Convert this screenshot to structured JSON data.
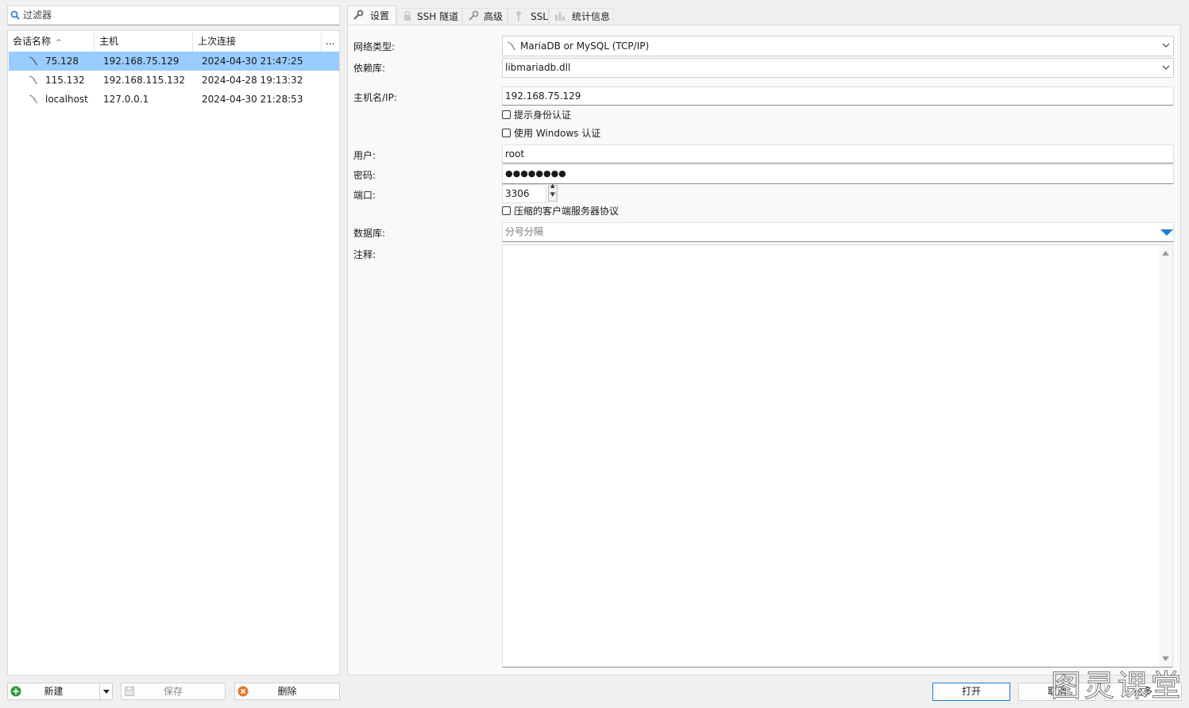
{
  "filter": {
    "placeholder": "过滤器"
  },
  "session_list": {
    "columns": [
      "会话名称",
      "主机",
      "上次连接",
      "..."
    ],
    "rows": [
      {
        "name": "75.128",
        "host": "192.168.75.129",
        "last": "2024-04-30 21:47:25",
        "selected": true
      },
      {
        "name": "115.132",
        "host": "192.168.115.132",
        "last": "2024-04-28 19:13:32",
        "selected": false
      },
      {
        "name": "localhost",
        "host": "127.0.0.1",
        "last": "2024-04-30 21:28:53",
        "selected": false
      }
    ]
  },
  "bottom_buttons": {
    "new": "新建",
    "save": "保存",
    "delete": "删除",
    "open": "打开",
    "cancel": "取消",
    "more": "更多"
  },
  "tabs": [
    {
      "label": "设置",
      "icon": "wrench-icon",
      "active": true
    },
    {
      "label": "SSH 隧道",
      "icon": "lock-icon",
      "active": false
    },
    {
      "label": "高级",
      "icon": "wrench-icon",
      "active": false
    },
    {
      "label": "SSL",
      "icon": "key-icon",
      "active": false
    },
    {
      "label": "统计信息",
      "icon": "bar-chart-icon",
      "active": false
    }
  ],
  "settings": {
    "network_type_label": "网络类型:",
    "network_type_value": "MariaDB or MySQL (TCP/IP)",
    "library_label": "依赖库:",
    "library_value": "libmariadb.dll",
    "host_label": "主机名/IP:",
    "host_value": "192.168.75.129",
    "prompt_auth": "提示身份认证",
    "windows_auth": "使用 Windows 认证",
    "user_label": "用户:",
    "user_value": "root",
    "password_label": "密码:",
    "password_value": "●●●●●●●●",
    "port_label": "端口:",
    "port_value": "3306",
    "compress": "压缩的客户端服务器协议",
    "database_label": "数据库:",
    "database_placeholder": "分号分隔",
    "notes_label": "注释:"
  },
  "watermark": "图灵课堂",
  "colors": {
    "selection": "#99ccff",
    "accent": "#1e7bd6",
    "add_green": "#2e9d3a",
    "delete_orange": "#e8762c"
  }
}
